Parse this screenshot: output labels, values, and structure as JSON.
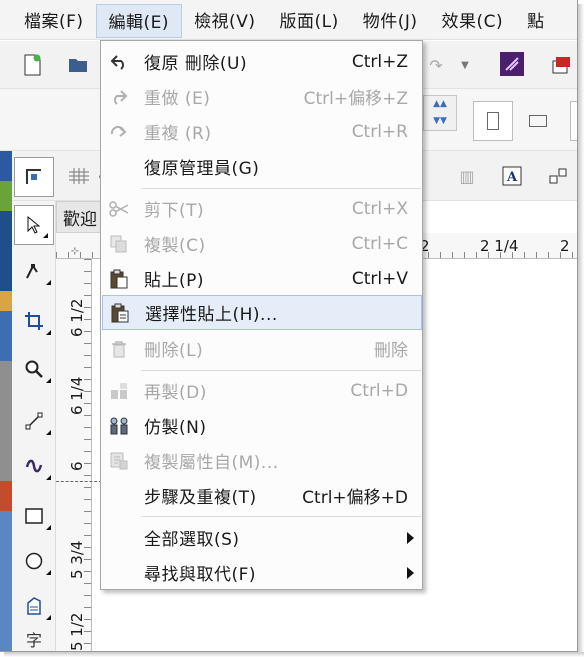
{
  "menubar": {
    "items": [
      {
        "label": "檔案(F)"
      },
      {
        "label": "編輯(E)"
      },
      {
        "label": "檢視(V)"
      },
      {
        "label": "版面(L)"
      },
      {
        "label": "物件(J)"
      },
      {
        "label": "效果(C)"
      },
      {
        "label": "點"
      }
    ],
    "active_index": 1
  },
  "toolbar": {
    "font_name": "字母"
  },
  "document_tab": {
    "label": "歡迎"
  },
  "rulers": {
    "horizontal_ticks": [
      "2",
      "2 1/4",
      "2"
    ],
    "vertical_ticks": [
      "6 1/2",
      "6 1/4",
      "6",
      "5 3/4",
      "5 1/2"
    ]
  },
  "edit_menu": {
    "items": [
      {
        "label": "復原 刪除(U)",
        "shortcut": "Ctrl+Z",
        "icon": "undo-icon",
        "enabled": true
      },
      {
        "label": "重做 (E)",
        "shortcut": "Ctrl+偏移+Z",
        "icon": "redo-icon",
        "enabled": false
      },
      {
        "label": "重複 (R)",
        "shortcut": "Ctrl+R",
        "icon": "repeat-icon",
        "enabled": false
      },
      {
        "label": "復原管理員(G)",
        "shortcut": "",
        "icon": "",
        "enabled": true
      },
      {
        "label": "剪下(T)",
        "shortcut": "Ctrl+X",
        "icon": "scissors-icon",
        "enabled": false
      },
      {
        "label": "複製(C)",
        "shortcut": "Ctrl+C",
        "icon": "copy-icon",
        "enabled": false
      },
      {
        "label": "貼上(P)",
        "shortcut": "Ctrl+V",
        "icon": "paste-icon",
        "enabled": true
      },
      {
        "label": "選擇性貼上(H)...",
        "shortcut": "",
        "icon": "paste-special-icon",
        "enabled": true,
        "highlighted": true
      },
      {
        "label": "刪除(L)",
        "shortcut": "刪除",
        "icon": "trash-icon",
        "enabled": false
      },
      {
        "label": "再製(D)",
        "shortcut": "Ctrl+D",
        "icon": "duplicate-icon",
        "enabled": false
      },
      {
        "label": "仿製(N)",
        "shortcut": "",
        "icon": "clone-icon",
        "enabled": true
      },
      {
        "label": "複製屬性自(M)...",
        "shortcut": "",
        "icon": "copy-properties-icon",
        "enabled": false
      },
      {
        "label": "步驟及重複(T)",
        "shortcut": "Ctrl+偏移+D",
        "icon": "",
        "enabled": true
      },
      {
        "label": "全部選取(S)",
        "shortcut": "",
        "icon": "",
        "enabled": true,
        "submenu": true
      },
      {
        "label": "尋找與取代(F)",
        "shortcut": "",
        "icon": "",
        "enabled": true,
        "submenu": true
      }
    ]
  },
  "colors": {
    "menu_highlight": "#e5eef8",
    "menu_highlight_border": "#a7c4e6",
    "disabled_text": "#a8a8a8"
  }
}
